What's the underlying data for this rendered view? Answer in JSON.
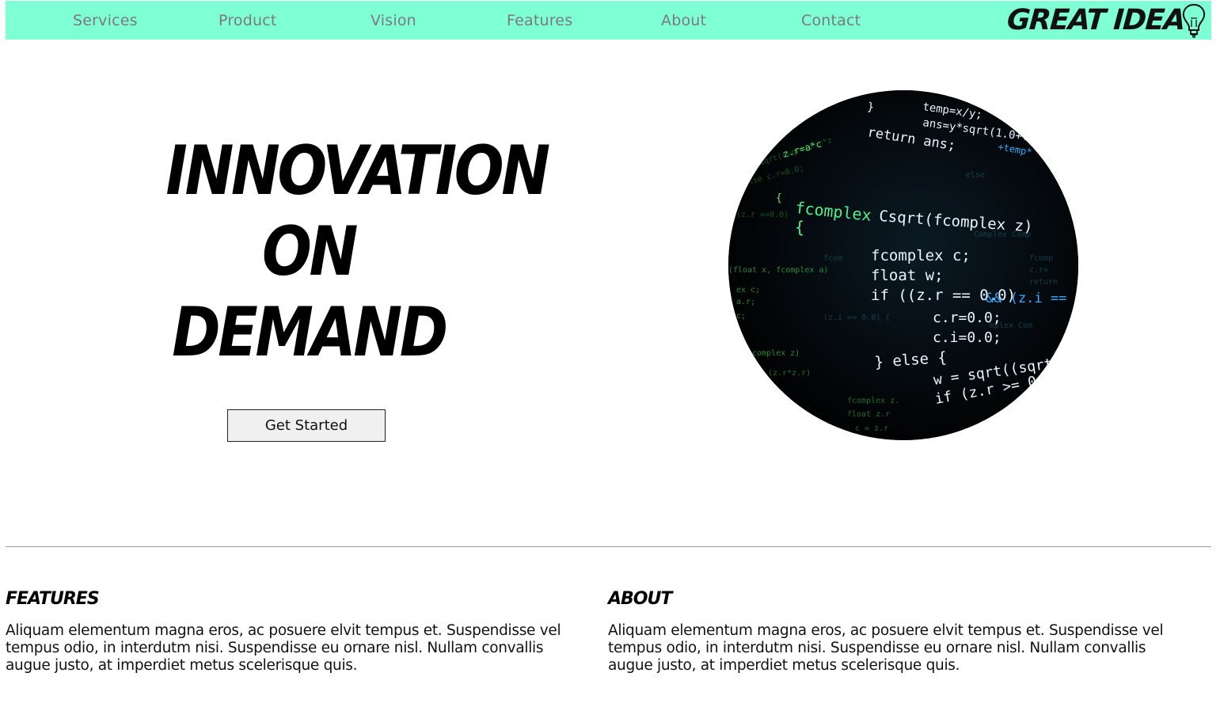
{
  "nav": {
    "items": [
      "Services",
      "Product",
      "Vision",
      "Features",
      "About",
      "Contact"
    ],
    "logo_text": "GREAT IDEA",
    "background": "#7fffd4"
  },
  "hero": {
    "title_lines": [
      "INNOVATION",
      "ON",
      "DEMAND"
    ],
    "cta_label": "Get Started",
    "image_icon": "code-image"
  },
  "sections": [
    {
      "heading": "FEATURES",
      "body": "Aliquam elementum magna eros, ac posuere elvit tempus et. Suspendisse vel tempus odio, in interdutm nisi. Suspendisse eu ornare nisl. Nullam convallis augue justo, at imperdiet metus scelerisque quis."
    },
    {
      "heading": "ABOUT",
      "body": "Aliquam elementum magna eros, ac posuere elvit tempus et. Suspendisse vel tempus odio, in interdutm nisi. Suspendisse eu ornare nisl. Nullam convallis augue justo, at imperdiet metus scelerisque quis."
    }
  ]
}
